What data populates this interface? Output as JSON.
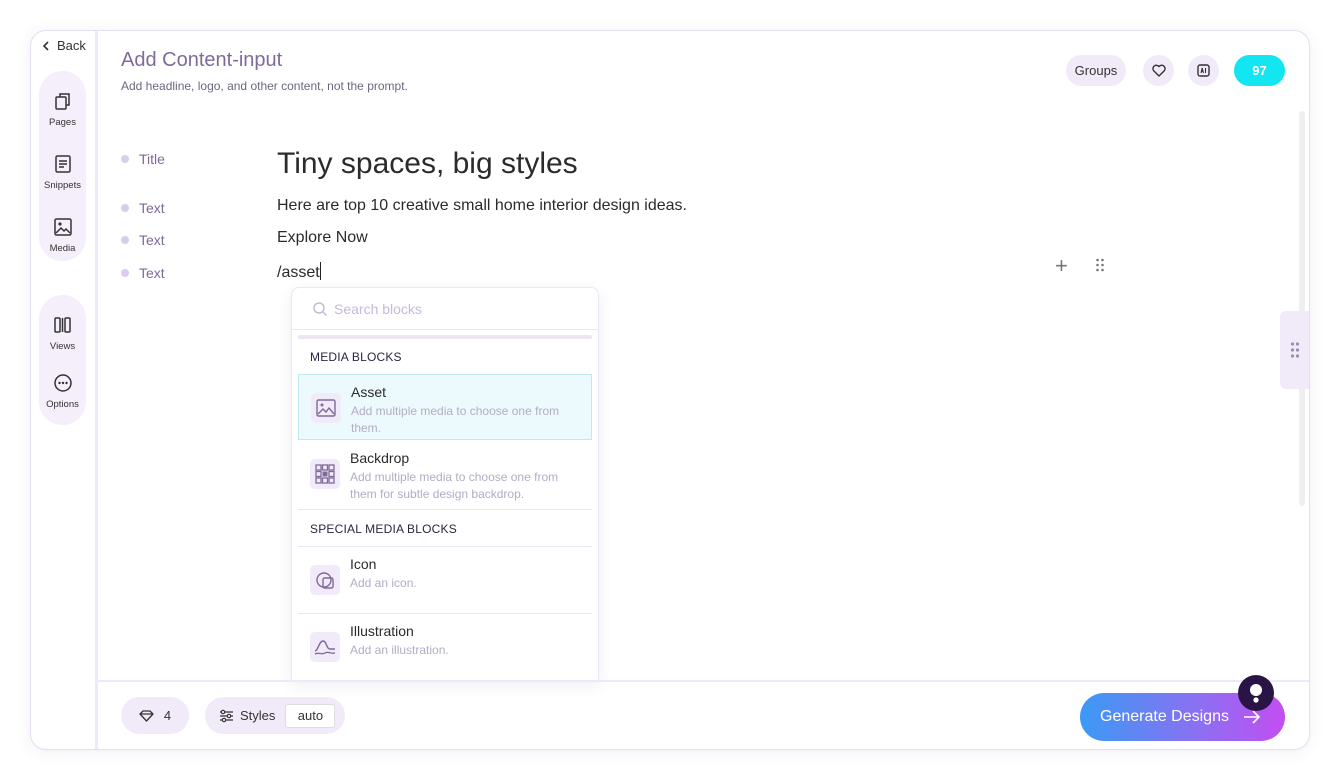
{
  "nav": {
    "back_label": "Back",
    "rail_top": [
      {
        "label": "Pages",
        "icon": "pages-icon"
      },
      {
        "label": "Snippets",
        "icon": "snippets-icon"
      },
      {
        "label": "Media",
        "icon": "media-icon"
      }
    ],
    "rail_bottom": [
      {
        "label": "Views",
        "icon": "views-icon"
      },
      {
        "label": "Options",
        "icon": "options-icon"
      }
    ]
  },
  "header": {
    "title": "Add Content-input",
    "subtitle": "Add headline, logo, and other content, not the prompt.",
    "groups_label": "Groups",
    "credits": "97"
  },
  "editor": {
    "rows": [
      {
        "label": "Title",
        "value": "Tiny spaces, big styles"
      },
      {
        "label": "Text",
        "value": "Here are top 10 creative small home interior design ideas."
      },
      {
        "label": "Text",
        "value": "Explore Now"
      },
      {
        "label": "Text",
        "value": "/asset"
      }
    ],
    "add_block": "+"
  },
  "block_menu": {
    "search_placeholder": "Search blocks",
    "section_media": "MEDIA BLOCKS",
    "section_special": "SPECIAL MEDIA BLOCKS",
    "items": [
      {
        "title": "Asset",
        "desc": "Add multiple media to choose one from them.",
        "icon": "image-icon"
      },
      {
        "title": "Backdrop",
        "desc": "Add multiple media to choose one from them for subtle design backdrop.",
        "icon": "pattern-icon"
      },
      {
        "title": "Icon",
        "desc": "Add an icon.",
        "icon": "shapes-icon"
      },
      {
        "title": "Illustration",
        "desc": "Add an illustration.",
        "icon": "wave-icon"
      }
    ]
  },
  "footer": {
    "gems": "4",
    "styles_label": "Styles",
    "styles_value": "auto",
    "generate_label": "Generate Designs"
  },
  "colors": {
    "accent": "#7f6a9a",
    "credits": "#13e6f0",
    "panel": "#f1ebf9"
  }
}
